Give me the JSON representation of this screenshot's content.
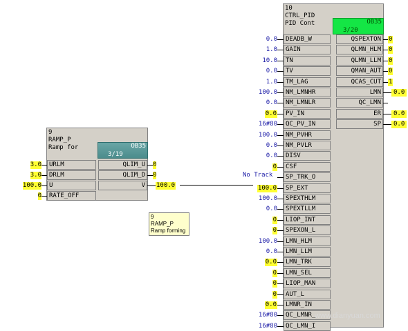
{
  "ramp_block": {
    "number": "9",
    "type": "RAMP_P",
    "comment": "Ramp for",
    "ob": "OB35",
    "sequence": "3/19",
    "inputs": [
      {
        "name": "URLM",
        "value": "3.0",
        "highlight": true
      },
      {
        "name": "DRLM",
        "value": "3.0",
        "highlight": true
      },
      {
        "name": "U",
        "value": "100.0",
        "highlight": true
      },
      {
        "name": "RATE_OFF",
        "value": "0",
        "highlight": true
      }
    ],
    "outputs": [
      {
        "name": "QLIM_U",
        "value": "0"
      },
      {
        "name": "QLIM_D",
        "value": "0"
      },
      {
        "name": "V",
        "value": "100.0"
      }
    ]
  },
  "ramp_tooltip": {
    "line1": "9",
    "line2": "RAMP_P",
    "line3": "Ramp forming"
  },
  "connection": {
    "label": "No Track"
  },
  "pid_block": {
    "number": "10",
    "type": "CTRL_PID",
    "comment": "PID Cont",
    "ob": "OB35",
    "sequence": "3/20",
    "inputs": [
      {
        "name": "DEADB_W",
        "value": "0.0",
        "highlight": false
      },
      {
        "name": "GAIN",
        "value": "1.0",
        "highlight": false
      },
      {
        "name": "TN",
        "value": "10.0",
        "highlight": false
      },
      {
        "name": "TV",
        "value": "0.0",
        "highlight": false
      },
      {
        "name": "TM_LAG",
        "value": "1.0",
        "highlight": false
      },
      {
        "name": "NM_LMNHR",
        "value": "100.0",
        "highlight": false
      },
      {
        "name": "NM_LMNLR",
        "value": "0.0",
        "highlight": false
      },
      {
        "name": "PV_IN",
        "value": "0.0",
        "highlight": true
      },
      {
        "name": "QC_PV_IN",
        "value": "16#80",
        "highlight": false
      },
      {
        "name": "NM_PVHR",
        "value": "100.0",
        "highlight": false
      },
      {
        "name": "NM_PVLR",
        "value": "0.0",
        "highlight": false
      },
      {
        "name": "DISV",
        "value": "0.0",
        "highlight": false
      },
      {
        "name": "CSF",
        "value": "0",
        "highlight": true
      },
      {
        "name": "SP_TRK_O",
        "value": "",
        "highlight": false
      },
      {
        "name": "SP_EXT",
        "value": "100.0",
        "highlight": true
      },
      {
        "name": "SPEXTHLM",
        "value": "100.0",
        "highlight": false
      },
      {
        "name": "SPEXTLLM",
        "value": "0.0",
        "highlight": false
      },
      {
        "name": "LIOP_INT",
        "value": "0",
        "highlight": true
      },
      {
        "name": "SPEXON_L",
        "value": "0",
        "highlight": true
      },
      {
        "name": "LMN_HLM",
        "value": "100.0",
        "highlight": false
      },
      {
        "name": "LMN_LLM",
        "value": "0.0",
        "highlight": false
      },
      {
        "name": "LMN_TRK",
        "value": "0.0",
        "highlight": true
      },
      {
        "name": "LMN_SEL",
        "value": "0",
        "highlight": true
      },
      {
        "name": "LIOP_MAN",
        "value": "0",
        "highlight": true
      },
      {
        "name": "AUT_L",
        "value": "0",
        "highlight": true
      },
      {
        "name": "LMNR_IN",
        "value": "0.0",
        "highlight": true
      },
      {
        "name": "QC_LMNR_",
        "value": "16#80",
        "highlight": false
      },
      {
        "name": "QC_LMN_I",
        "value": "16#80",
        "highlight": false
      }
    ],
    "outputs": [
      {
        "name": "QSPEXTON",
        "value": "0",
        "highlight": true
      },
      {
        "name": "QLMN_HLM",
        "value": "0",
        "highlight": true
      },
      {
        "name": "QLMN_LLM",
        "value": "0",
        "highlight": true
      },
      {
        "name": "QMAN_AUT",
        "value": "0",
        "highlight": true
      },
      {
        "name": "QCAS_CUT",
        "value": "1",
        "highlight": true
      },
      {
        "name": "LMN",
        "value": "0.0",
        "highlight": true
      },
      {
        "name": "QC_LMN",
        "value": "",
        "highlight": false
      },
      {
        "name": "ER",
        "value": "0.0",
        "highlight": true
      },
      {
        "name": "SP",
        "value": "0.0",
        "highlight": true
      }
    ]
  },
  "watermark": "www.dianyuan.com"
}
